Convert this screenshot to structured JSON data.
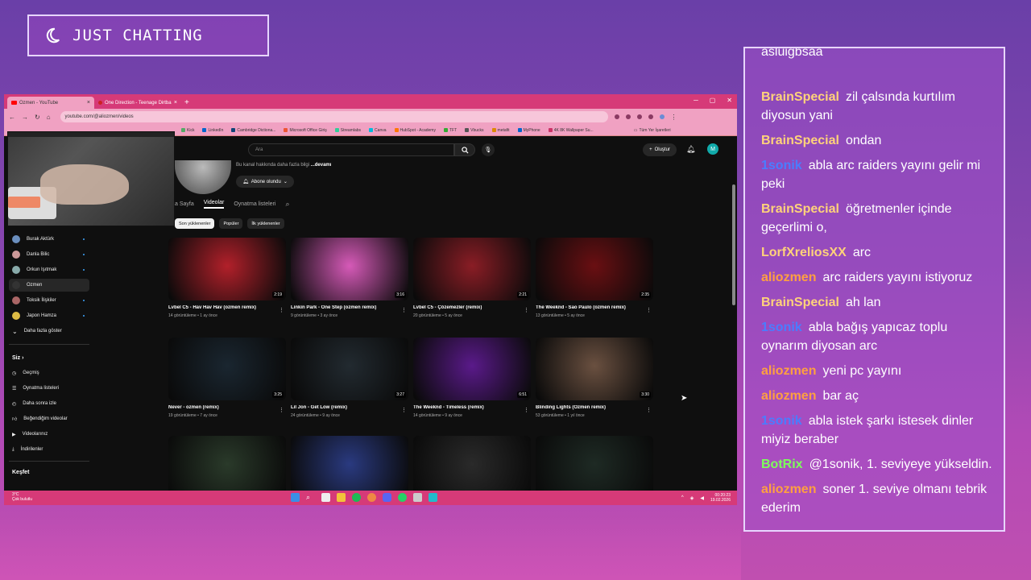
{
  "scene": {
    "title": "JUST CHATTING"
  },
  "browser": {
    "tabs": [
      {
        "label": "Ozmen - YouTube",
        "active": true
      },
      {
        "label": "One Direction - Teenage Dirtba",
        "active": false
      }
    ],
    "url": "youtube.com/@aliozmen/videos",
    "bookmarks": [
      "Kick",
      "LinkedIn",
      "Cambridge Dictiona...",
      "Microsoft Office Giriş",
      "Streamlabs",
      "Canva",
      "HubSpot - Academy",
      "TFT",
      "Vbucks",
      "metafit",
      "MyPhone",
      "4K 8K Wallpaper Su..."
    ],
    "bookmarks_other": "Tüm Yer İşaretleri"
  },
  "youtube": {
    "search_placeholder": "Ara",
    "create_label": "Oluştur",
    "user_initial": "M",
    "channel_desc": "Bu kanal hakkında daha fazla bilgi",
    "channel_more": "...devamı",
    "subscribe_label": "Abone olundu",
    "channel_tabs": [
      "a Sayfa",
      "Videolar",
      "Oynatma listeleri"
    ],
    "chips": [
      "Son yüklenenler",
      "Popüler",
      "İlk yüklenenler"
    ],
    "subscriptions": [
      "Burak Aktürk",
      "Danla Bilic",
      "Orkun Işıtmak",
      "Ozmen",
      "Toksik İlişkiler",
      "Japon Hamza"
    ],
    "show_more": "Daha fazla göster",
    "you_head": "Siz",
    "you_items": [
      "Geçmiş",
      "Oynatma listeleri",
      "Daha sonra izle",
      "Beğendiğim videolar",
      "Videolarınız",
      "İndirilenler"
    ],
    "explore_head": "Keşfet",
    "videos": [
      {
        "title": "Lvbel C5 - Hav Hav Hav (ozmen remix)",
        "meta": "14 görüntüleme • 1 ay önce",
        "duration": "2:19",
        "color": "#b2202a"
      },
      {
        "title": "Linkin Park - One Step (ozmen remix)",
        "meta": "9 görüntüleme • 3 ay önce",
        "duration": "3:16",
        "color": "#d65ab8"
      },
      {
        "title": "Lvbel C5 - Çözemezler (remix)",
        "meta": "20 görüntüleme • 5 ay önce",
        "duration": "2:21",
        "color": "#8a1d25"
      },
      {
        "title": "The Weeknd - Sao Paulo (ozmen remix)",
        "meta": "13 görüntüleme • 5 ay önce",
        "duration": "2:35",
        "color": "#6a0f12"
      },
      {
        "title": "Never - ozmen (remix)",
        "meta": "19 görüntüleme • 7 ay önce",
        "duration": "3:25",
        "color": "#1a2630"
      },
      {
        "title": "Lil Jon - Get Low (remix)",
        "meta": "24 görüntüleme • 9 ay önce",
        "duration": "3:27",
        "color": "#222a30"
      },
      {
        "title": "The Weeknd - Timeless (remix)",
        "meta": "14 görüntüleme • 9 ay önce",
        "duration": "6:51",
        "color": "#5a1a8a"
      },
      {
        "title": "Blinding Lights (Ozmen remix)",
        "meta": "53 görüntüleme • 1 yıl önce",
        "duration": "3:30",
        "color": "#6a5040"
      },
      {
        "title": "",
        "meta": "",
        "duration": "",
        "color": "#2a3a2a"
      },
      {
        "title": "",
        "meta": "",
        "duration": "",
        "color": "#2a3a80"
      },
      {
        "title": "",
        "meta": "",
        "duration": "",
        "color": "#2a2a2a"
      },
      {
        "title": "",
        "meta": "",
        "duration": "",
        "color": "#1e2a24"
      }
    ]
  },
  "taskbar": {
    "weather_temp": "3°C",
    "weather_desc": "Çok bulutlu",
    "time": "00:20:23",
    "date": "19.02.2026"
  },
  "chat": {
    "partial_top": "asluigbsaa",
    "messages": [
      {
        "user": "BrainSpecial",
        "color": "#ffd27a",
        "text": "zil çalsında kurtılım diyosun yani"
      },
      {
        "user": "BrainSpecial",
        "color": "#ffd27a",
        "text": "ondan"
      },
      {
        "user": "1sonik",
        "color": "#4a7dff",
        "text": "abla arc raiders yayını gelir mi peki"
      },
      {
        "user": "BrainSpecial",
        "color": "#ffd27a",
        "text": "öğretmenler içinde geçerlimi o,"
      },
      {
        "user": "LorfXreliosXX",
        "color": "#ffd27a",
        "text": "arc"
      },
      {
        "user": "aliozmen",
        "color": "#ffa040",
        "text": "arc raiders yayını istiyoruz"
      },
      {
        "user": "BrainSpecial",
        "color": "#ffd27a",
        "text": "ah lan"
      },
      {
        "user": "1sonik",
        "color": "#4a7dff",
        "text": "abla bağış yapıcaz toplu oynarım diyosan arc"
      },
      {
        "user": "aliozmen",
        "color": "#ffa040",
        "text": "yeni pc yayını"
      },
      {
        "user": "aliozmen",
        "color": "#ffa040",
        "text": "bar aç"
      },
      {
        "user": "1sonik",
        "color": "#4a7dff",
        "text": "abla istek şarkı istesek dinler miyiz beraber"
      },
      {
        "user": "BotRix",
        "color": "#7cff5a",
        "text": "@1sonik, 1. seviyeye yükseldin."
      },
      {
        "user": "aliozmen",
        "color": "#ffa040",
        "text": "soner 1. seviye olmanı tebrik ederim"
      }
    ]
  }
}
